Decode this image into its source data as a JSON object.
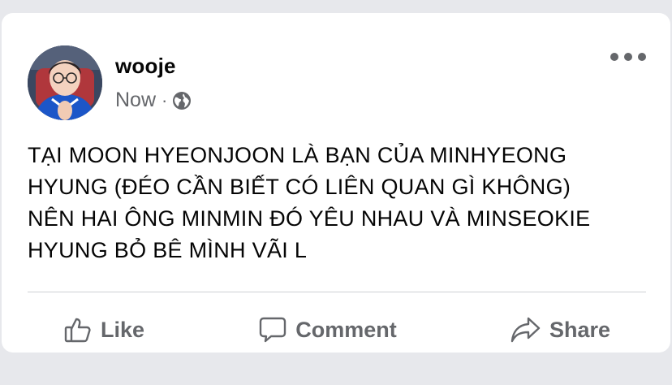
{
  "post": {
    "author": "wooje",
    "time": "Now",
    "separator": "·",
    "privacy_icon": "globe-icon",
    "text": "TẠI MOON HYEONJOON LÀ BẠN CỦA MINHYEONG\nHYUNG (ĐÉO CẦN BIẾT CÓ LIÊN QUAN GÌ KHÔNG)\nNÊN HAI ÔNG MINMIN ĐÓ YÊU NHAU VÀ MINSEOKIE\nHYUNG BỎ BÊ MÌNH VÃI L"
  },
  "actions": {
    "like": {
      "label": "Like",
      "icon": "thumbs-up-icon"
    },
    "comment": {
      "label": "Comment",
      "icon": "comment-bubble-icon"
    },
    "share": {
      "label": "Share",
      "icon": "share-arrow-icon"
    }
  },
  "colors": {
    "page_background": "#e7e8ec",
    "card_background": "#ffffff",
    "primary_text": "#050505",
    "secondary_text": "#65676b",
    "divider": "#ced0d4"
  }
}
